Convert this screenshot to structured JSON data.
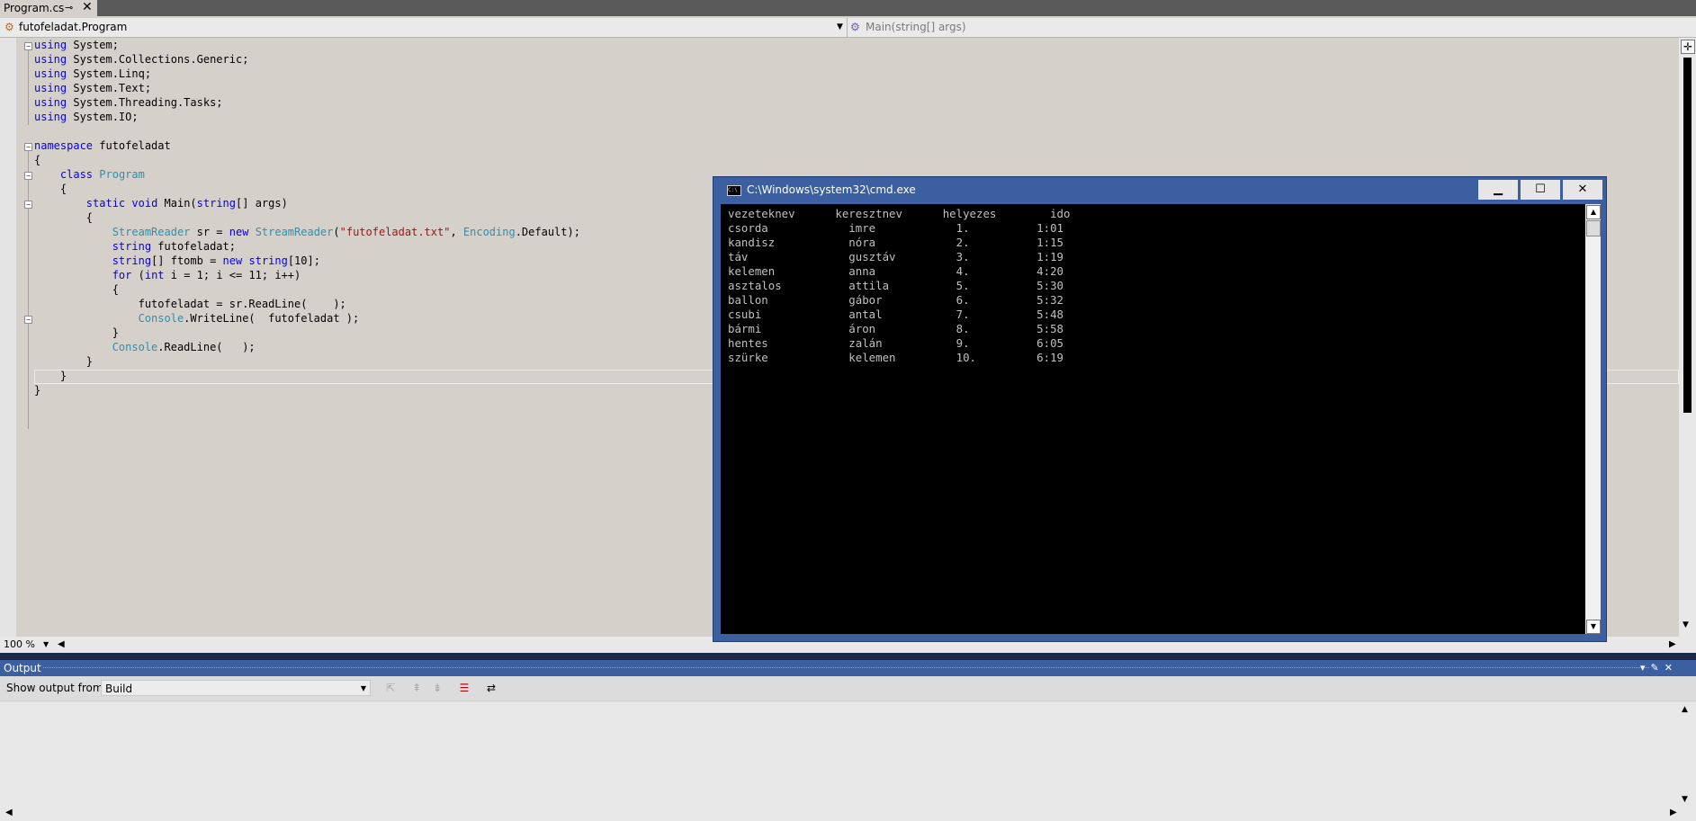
{
  "tab": {
    "label": "Program.cs",
    "pin": "⊸",
    "close": "✕"
  },
  "navbar": {
    "class_selector": "futofeladat.Program",
    "member_selector": "Main(string[] args)"
  },
  "editor": {
    "lines": [
      {
        "segs": [
          {
            "t": "using",
            "c": "kw"
          },
          {
            "t": " System;"
          }
        ]
      },
      {
        "segs": [
          {
            "t": "using",
            "c": "kw"
          },
          {
            "t": " System.Collections.Generic;"
          }
        ]
      },
      {
        "segs": [
          {
            "t": "using",
            "c": "kw"
          },
          {
            "t": " System.Linq;"
          }
        ]
      },
      {
        "segs": [
          {
            "t": "using",
            "c": "kw"
          },
          {
            "t": " System.Text;"
          }
        ]
      },
      {
        "segs": [
          {
            "t": "using",
            "c": "kw"
          },
          {
            "t": " System.Threading.Tasks;"
          }
        ]
      },
      {
        "segs": [
          {
            "t": "using",
            "c": "kw"
          },
          {
            "t": " System.IO;"
          }
        ]
      },
      {
        "segs": []
      },
      {
        "segs": [
          {
            "t": "namespace",
            "c": "kw"
          },
          {
            "t": " futofeladat"
          }
        ]
      },
      {
        "segs": [
          {
            "t": "{"
          }
        ]
      },
      {
        "segs": [
          {
            "t": "    "
          },
          {
            "t": "class",
            "c": "kw"
          },
          {
            "t": " "
          },
          {
            "t": "Program",
            "c": "ty"
          }
        ]
      },
      {
        "segs": [
          {
            "t": "    {"
          }
        ]
      },
      {
        "segs": [
          {
            "t": "        "
          },
          {
            "t": "static",
            "c": "kw"
          },
          {
            "t": " "
          },
          {
            "t": "void",
            "c": "kw"
          },
          {
            "t": " Main("
          },
          {
            "t": "string",
            "c": "kw"
          },
          {
            "t": "[] args)"
          }
        ]
      },
      {
        "segs": [
          {
            "t": "        {"
          }
        ]
      },
      {
        "segs": [
          {
            "t": "            "
          },
          {
            "t": "StreamReader",
            "c": "ty"
          },
          {
            "t": " sr = "
          },
          {
            "t": "new",
            "c": "kw"
          },
          {
            "t": " "
          },
          {
            "t": "StreamReader",
            "c": "ty"
          },
          {
            "t": "("
          },
          {
            "t": "\"futofeladat.txt\"",
            "c": "st"
          },
          {
            "t": ", "
          },
          {
            "t": "Encoding",
            "c": "ty"
          },
          {
            "t": ".Default);"
          }
        ]
      },
      {
        "segs": [
          {
            "t": "            "
          },
          {
            "t": "string",
            "c": "kw"
          },
          {
            "t": " futofeladat;"
          }
        ]
      },
      {
        "segs": [
          {
            "t": "            "
          },
          {
            "t": "string",
            "c": "kw"
          },
          {
            "t": "[] ftomb = "
          },
          {
            "t": "new",
            "c": "kw"
          },
          {
            "t": " "
          },
          {
            "t": "string",
            "c": "kw"
          },
          {
            "t": "[10];"
          }
        ]
      },
      {
        "segs": [
          {
            "t": "            "
          },
          {
            "t": "for",
            "c": "kw"
          },
          {
            "t": " ("
          },
          {
            "t": "int",
            "c": "kw"
          },
          {
            "t": " i = 1; i <= 11; i++)"
          }
        ]
      },
      {
        "segs": [
          {
            "t": "            {"
          }
        ]
      },
      {
        "segs": [
          {
            "t": "                futofeladat = sr.ReadLine(    );"
          }
        ]
      },
      {
        "segs": [
          {
            "t": "                "
          },
          {
            "t": "Console",
            "c": "ty"
          },
          {
            "t": ".WriteLine(  futofeladat );"
          }
        ]
      },
      {
        "segs": [
          {
            "t": "            }"
          }
        ]
      },
      {
        "segs": [
          {
            "t": "            "
          },
          {
            "t": "Console",
            "c": "ty"
          },
          {
            "t": ".ReadLine(   );"
          }
        ]
      },
      {
        "segs": [
          {
            "t": "        }"
          }
        ]
      },
      {
        "segs": [
          {
            "t": "    }"
          }
        ]
      },
      {
        "segs": [
          {
            "t": "}"
          }
        ]
      }
    ]
  },
  "zoom": "100 %",
  "output": {
    "title": "Output",
    "show_from_label": "Show output from:",
    "source": "Build"
  },
  "cmd": {
    "title": "C:\\Windows\\system32\\cmd.exe",
    "minimize": "▁",
    "maximize": "☐",
    "close": "✕",
    "lines": [
      "vezeteknev      keresztnev      helyezes        ido",
      "csorda            imre            1.          1:01",
      "kandisz           nóra            2.          1:15",
      "táv               gusztáv         3.          1:19",
      "kelemen           anna            4.          4:20",
      "asztalos          attila          5.          5:30",
      "ballon            gábor           6.          5:32",
      "csubi             antal           7.          5:48",
      "bármi             áron            8.          5:58",
      "hentes            zalán           9.          6:05",
      "szürke            kelemen         10.         6:19"
    ]
  }
}
